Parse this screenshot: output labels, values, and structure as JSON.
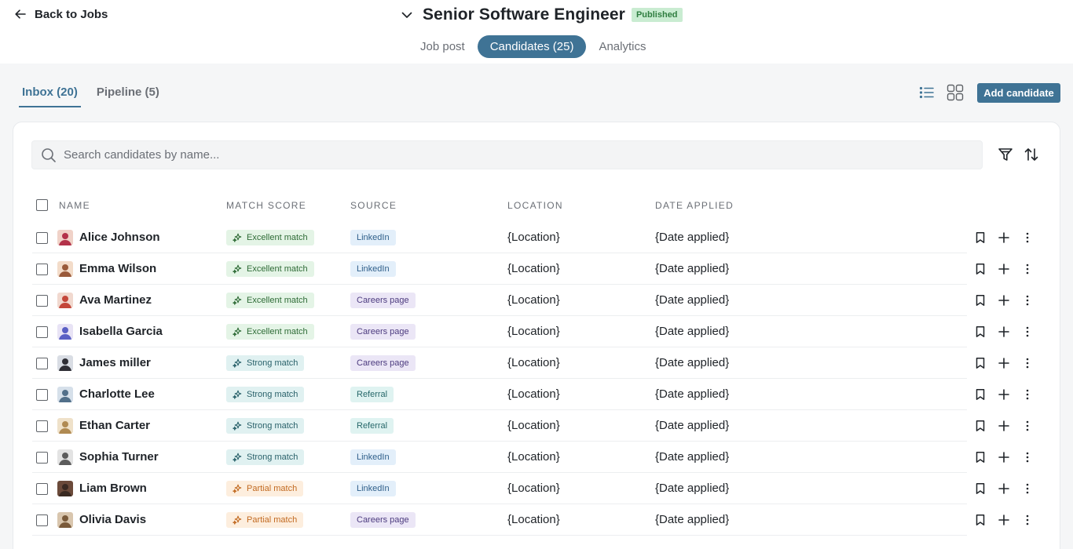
{
  "header": {
    "back_label": "Back to Jobs",
    "job_title": "Senior Software Engineer",
    "status_badge": "Published"
  },
  "main_tabs": [
    {
      "label": "Job post",
      "active": false
    },
    {
      "label": "Candidates (25)",
      "active": true
    },
    {
      "label": "Analytics",
      "active": false
    }
  ],
  "sub_tabs": [
    {
      "label": "Inbox (20)",
      "active": true
    },
    {
      "label": "Pipeline (5)",
      "active": false
    }
  ],
  "toolbar": {
    "add_candidate_label": "Add candidate",
    "view_icons": [
      "list-view-icon",
      "grid-view-icon"
    ]
  },
  "search": {
    "placeholder": "Search candidates by name...",
    "value": ""
  },
  "table": {
    "columns": [
      "NAME",
      "MATCH SCORE",
      "SOURCE",
      "LOCATION",
      "DATE APPLIED"
    ],
    "rows": [
      {
        "name": "Alice Johnson",
        "match": "Excellent match",
        "match_level": "excellent",
        "source": "LinkedIn",
        "source_type": "linkedin",
        "location": "{Location}",
        "date_applied": "{Date applied}"
      },
      {
        "name": "Emma Wilson",
        "match": "Excellent match",
        "match_level": "excellent",
        "source": "LinkedIn",
        "source_type": "linkedin",
        "location": "{Location}",
        "date_applied": "{Date applied}"
      },
      {
        "name": "Ava Martinez",
        "match": "Excellent match",
        "match_level": "excellent",
        "source": "Careers page",
        "source_type": "careers",
        "location": "{Location}",
        "date_applied": "{Date applied}"
      },
      {
        "name": "Isabella Garcia",
        "match": "Excellent match",
        "match_level": "excellent",
        "source": "Careers page",
        "source_type": "careers",
        "location": "{Location}",
        "date_applied": "{Date applied}"
      },
      {
        "name": "James miller",
        "match": "Strong match",
        "match_level": "strong",
        "source": "Careers page",
        "source_type": "careers",
        "location": "{Location}",
        "date_applied": "{Date applied}"
      },
      {
        "name": "Charlotte Lee",
        "match": "Strong match",
        "match_level": "strong",
        "source": "Referral",
        "source_type": "referral",
        "location": "{Location}",
        "date_applied": "{Date applied}"
      },
      {
        "name": "Ethan Carter",
        "match": "Strong match",
        "match_level": "strong",
        "source": "Referral",
        "source_type": "referral",
        "location": "{Location}",
        "date_applied": "{Date applied}"
      },
      {
        "name": "Sophia Turner",
        "match": "Strong match",
        "match_level": "strong",
        "source": "LinkedIn",
        "source_type": "linkedin",
        "location": "{Location}",
        "date_applied": "{Date applied}"
      },
      {
        "name": "Liam Brown",
        "match": "Partial match",
        "match_level": "partial",
        "source": "LinkedIn",
        "source_type": "linkedin",
        "location": "{Location}",
        "date_applied": "{Date applied}"
      },
      {
        "name": "Olivia Davis",
        "match": "Partial match",
        "match_level": "partial",
        "source": "Careers page",
        "source_type": "careers",
        "location": "{Location}",
        "date_applied": "{Date applied}"
      }
    ],
    "row_actions": [
      "bookmark-icon",
      "plus-icon",
      "more-vertical-icon"
    ]
  },
  "colors": {
    "accent": "#3f7395",
    "published_bg": "#c9ecd1",
    "excellent_bg": "#e4f4e6",
    "strong_bg": "#e0f1f1",
    "partial_bg": "#fdeede",
    "linkedin_bg": "#e3effa",
    "careers_bg": "#ebe6f6",
    "referral_bg": "#dff3f1"
  },
  "avatar_colors": [
    [
      "#b3324a",
      "#f0d2c8"
    ],
    [
      "#9a5a3a",
      "#f3dcc9"
    ],
    [
      "#c4473a",
      "#f1d9cf"
    ],
    [
      "#5a5fc4",
      "#e8e3f5"
    ],
    [
      "#2f2f36",
      "#d9dde4"
    ],
    [
      "#52708a",
      "#d6e0ea"
    ],
    [
      "#b08a52",
      "#efe1c9"
    ],
    [
      "#5c5c5c",
      "#e3e3e3"
    ],
    [
      "#3a2a22",
      "#6b4a3a"
    ],
    [
      "#7a5a3a",
      "#d9c6ae"
    ]
  ]
}
